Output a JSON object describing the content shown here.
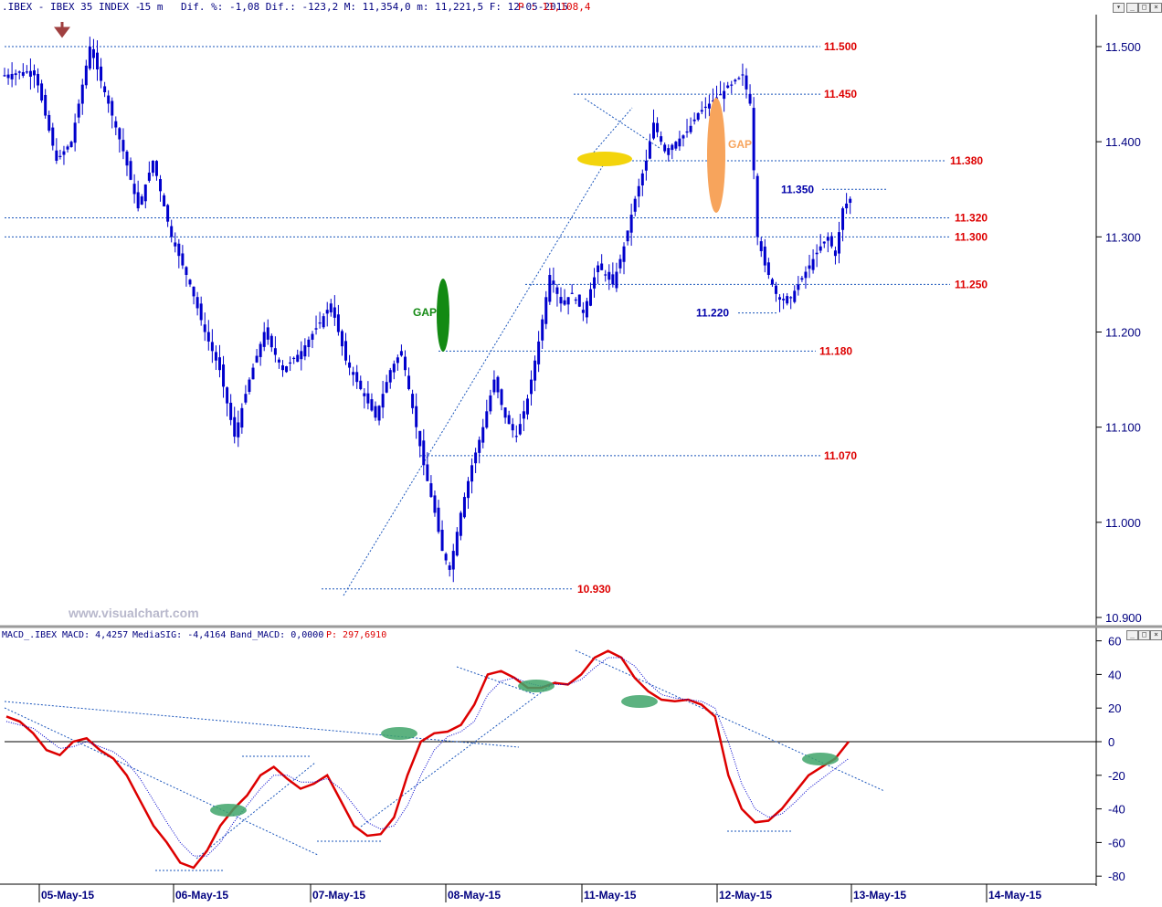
{
  "header": {
    "symbol": ".IBEX - IBEX 35 INDEX -",
    "timeframe": "15 m",
    "stats": "Dif. %: -1,08 Dif.: -123,2 M: 11,354,0 m: 11,221,5 F: 12-05-2015",
    "price_label": "P : 11,108,4"
  },
  "watermark": "www.visualchart.com",
  "macd_header": {
    "name": "MACD_.IBEX",
    "macd": "MACD: 4,4257",
    "signal": "MediaSIG: -4,4164",
    "band": "Band_MACD: 0,0000",
    "p": "P: 297,6910"
  },
  "colors": {
    "candle": "#0000cc",
    "level_red": "#dd0000",
    "level_blue": "#0000aa",
    "dotted_line": "#1a55bb",
    "gap_green": "#138a13",
    "gap_orange": "#f7a45c",
    "gap_yellow": "#f3d40c",
    "macd_line": "#dd0000",
    "signal_line": "#0000cc",
    "oval_macd": "#3fa56a",
    "arrow": "#a04040",
    "axis_text": "#000080"
  },
  "chart_data": [
    {
      "type": "candlestick",
      "title": "IBEX 35 INDEX - 15 m",
      "ylim": [
        10900,
        11550
      ],
      "y_ticks": [
        "11.500",
        "11.400",
        "11.300",
        "11.200",
        "11.100",
        "11.000",
        "10.900"
      ],
      "x_labels": [
        "05-May-15",
        "06-May-15",
        "07-May-15",
        "08-May-15",
        "11-May-15",
        "12-May-15",
        "13-May-15",
        "14-May-15"
      ],
      "levels": [
        {
          "value": 11500,
          "label": "11.500",
          "color": "red"
        },
        {
          "value": 11450,
          "label": "11.450",
          "color": "red"
        },
        {
          "value": 11380,
          "label": "11.380",
          "color": "red"
        },
        {
          "value": 11350,
          "label": "11.350",
          "color": "blue"
        },
        {
          "value": 11320,
          "label": "11.320",
          "color": "red"
        },
        {
          "value": 11300,
          "label": "11.300",
          "color": "red"
        },
        {
          "value": 11250,
          "label": "11.250",
          "color": "red"
        },
        {
          "value": 11220,
          "label": "11.220",
          "color": "blue"
        },
        {
          "value": 11180,
          "label": "11.180",
          "color": "red"
        },
        {
          "value": 11070,
          "label": "11.070",
          "color": "red"
        },
        {
          "value": 10930,
          "label": "10.930",
          "color": "red"
        }
      ],
      "annotations": [
        {
          "text": "GAP",
          "color": "green"
        },
        {
          "text": "GAP",
          "color": "orange"
        }
      ],
      "price_path": [
        [
          0,
          11470
        ],
        [
          8,
          11475
        ],
        [
          14,
          11380
        ],
        [
          18,
          11400
        ],
        [
          23,
          11500
        ],
        [
          28,
          11440
        ],
        [
          32,
          11390
        ],
        [
          36,
          11330
        ],
        [
          40,
          11380
        ],
        [
          45,
          11300
        ],
        [
          50,
          11250
        ],
        [
          54,
          11200
        ],
        [
          58,
          11160
        ],
        [
          62,
          11090
        ],
        [
          66,
          11150
        ],
        [
          70,
          11200
        ],
        [
          75,
          11160
        ],
        [
          80,
          11180
        ],
        [
          85,
          11210
        ],
        [
          88,
          11230
        ],
        [
          92,
          11170
        ],
        [
          96,
          11140
        ],
        [
          100,
          11110
        ],
        [
          104,
          11160
        ],
        [
          107,
          11180
        ],
        [
          110,
          11120
        ],
        [
          113,
          11060
        ],
        [
          116,
          11010
        ],
        [
          118,
          10970
        ],
        [
          120,
          10950
        ],
        [
          123,
          11010
        ],
        [
          126,
          11060
        ],
        [
          129,
          11100
        ],
        [
          132,
          11150
        ],
        [
          135,
          11110
        ],
        [
          138,
          11090
        ],
        [
          141,
          11130
        ],
        [
          144,
          11190
        ],
        [
          147,
          11260
        ],
        [
          150,
          11230
        ],
        [
          153,
          11240
        ],
        [
          156,
          11220
        ],
        [
          160,
          11270
        ],
        [
          164,
          11250
        ],
        [
          167,
          11290
        ],
        [
          170,
          11340
        ],
        [
          173,
          11380
        ],
        [
          175,
          11420
        ],
        [
          178,
          11390
        ],
        [
          181,
          11400
        ],
        [
          184,
          11410
        ],
        [
          187,
          11430
        ],
        [
          190,
          11440
        ],
        [
          193,
          11450
        ],
        [
          196,
          11460
        ],
        [
          199,
          11470
        ],
        [
          201,
          11440
        ],
        [
          203,
          11300
        ],
        [
          205,
          11270
        ],
        [
          208,
          11240
        ],
        [
          211,
          11230
        ],
        [
          214,
          11250
        ],
        [
          217,
          11270
        ],
        [
          220,
          11290
        ],
        [
          222,
          11300
        ],
        [
          224,
          11280
        ],
        [
          226,
          11330
        ],
        [
          228,
          11340
        ]
      ]
    },
    {
      "type": "line",
      "title": "MACD",
      "ylim": [
        -80,
        60
      ],
      "y_ticks": [
        "60",
        "40",
        "20",
        "0",
        "-20",
        "-40",
        "-60",
        "-80"
      ],
      "series": [
        {
          "name": "MACD",
          "values": [
            15,
            12,
            5,
            -5,
            -8,
            0,
            2,
            -5,
            -10,
            -20,
            -35,
            -50,
            -60,
            -72,
            -75,
            -65,
            -50,
            -40,
            -32,
            -20,
            -15,
            -22,
            -28,
            -25,
            -20,
            -35,
            -50,
            -56,
            -55,
            -45,
            -20,
            0,
            5,
            6,
            10,
            22,
            40,
            42,
            38,
            32,
            32,
            35,
            34,
            40,
            50,
            54,
            50,
            38,
            30,
            25,
            24,
            25,
            22,
            15,
            -20,
            -40,
            -48,
            -47,
            -40,
            -30,
            -20,
            -15,
            -10,
            0
          ]
        },
        {
          "name": "MediaSIG",
          "values": [
            12,
            10,
            8,
            2,
            -4,
            -3,
            0,
            -3,
            -6,
            -12,
            -22,
            -35,
            -48,
            -60,
            -68,
            -68,
            -60,
            -48,
            -38,
            -28,
            -20,
            -20,
            -24,
            -24,
            -22,
            -28,
            -38,
            -48,
            -52,
            -50,
            -38,
            -20,
            -5,
            3,
            6,
            12,
            28,
            36,
            38,
            35,
            33,
            34,
            34,
            37,
            44,
            50,
            50,
            45,
            35,
            28,
            26,
            25,
            24,
            20,
            0,
            -25,
            -40,
            -45,
            -43,
            -36,
            -28,
            -22,
            -16,
            -10
          ]
        }
      ]
    }
  ]
}
